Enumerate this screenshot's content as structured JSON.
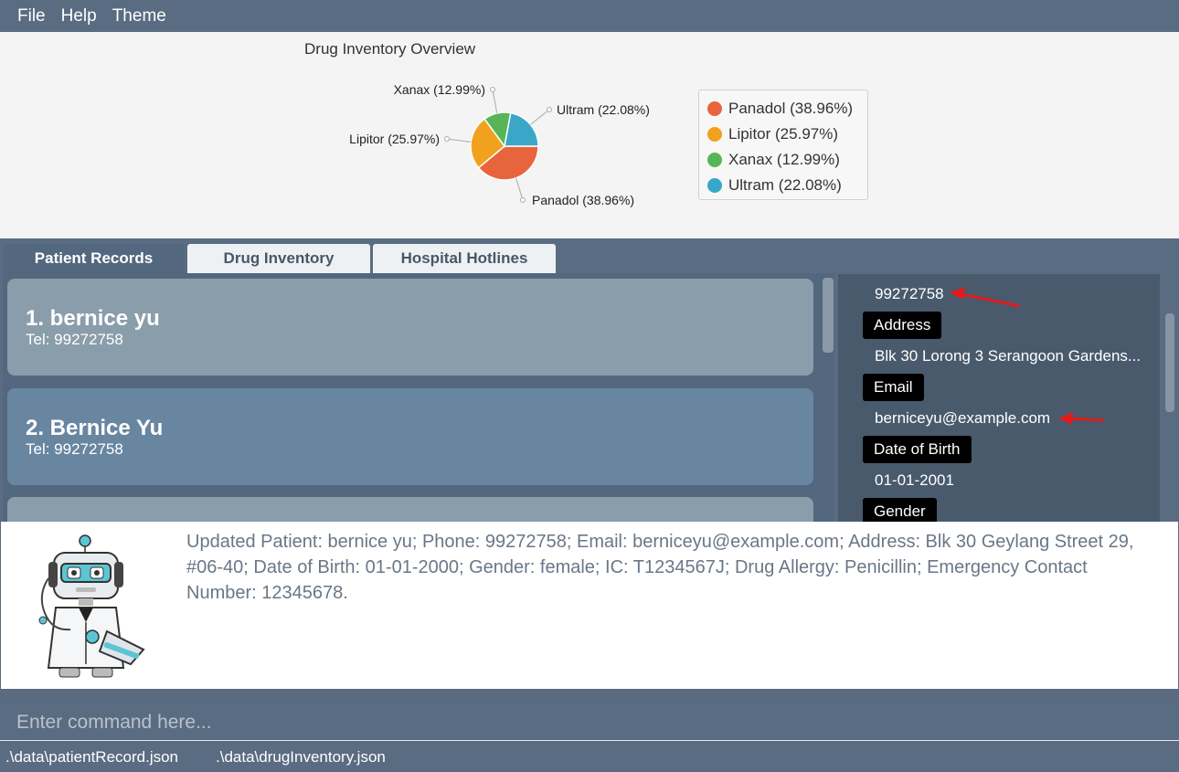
{
  "menu": [
    "File",
    "Help",
    "Theme"
  ],
  "chart_data": {
    "type": "pie",
    "title": "Drug Inventory Overview",
    "slices": [
      {
        "label": "Panadol (38.96%)",
        "value": 38.96,
        "color": "#e8643c"
      },
      {
        "label": "Lipitor (25.97%)",
        "value": 25.97,
        "color": "#f0a21e"
      },
      {
        "label": "Xanax (12.99%)",
        "value": 12.99,
        "color": "#58b556"
      },
      {
        "label": "Ultram (22.08%)",
        "value": 22.08,
        "color": "#3aa7c9"
      }
    ],
    "legend_position": "right"
  },
  "tabs": [
    {
      "label": "Patient Records",
      "active": true
    },
    {
      "label": "Drug Inventory",
      "active": false
    },
    {
      "label": "Hospital Hotlines",
      "active": false
    }
  ],
  "patients": [
    {
      "name": "1.  bernice yu",
      "tel": "Tel: 99272758",
      "color": "#8a9dab"
    },
    {
      "name": "2.  Bernice Yu",
      "tel": "Tel: 99272758",
      "color": "#6986a1"
    },
    {
      "name": "",
      "tel": "",
      "color": "#8a9dab"
    }
  ],
  "details": {
    "phone": "99272758",
    "address_label": "Address",
    "address": "Blk 30 Lorong 3 Serangoon Gardens...",
    "email_label": "Email",
    "email": "berniceyu@example.com",
    "dob_label": "Date of Birth",
    "dob": "01-01-2001",
    "gender_label": "Gender"
  },
  "annotation_arrow_color": "#e01b1b",
  "result": {
    "text": "Updated Patient: bernice yu; Phone: 99272758; Email: berniceyu@example.com; Address: Blk 30 Geylang Street 29, #06-40; Date of Birth: 01-01-2000; Gender: female; IC: T1234567J; Drug Allergy: Penicillin; Emergency Contact Number: 12345678."
  },
  "command": {
    "placeholder": "Enter command here...",
    "value": ""
  },
  "status": {
    "patient_file": ".\\data\\patientRecord.json",
    "drug_file": ".\\data\\drugInventory.json"
  }
}
